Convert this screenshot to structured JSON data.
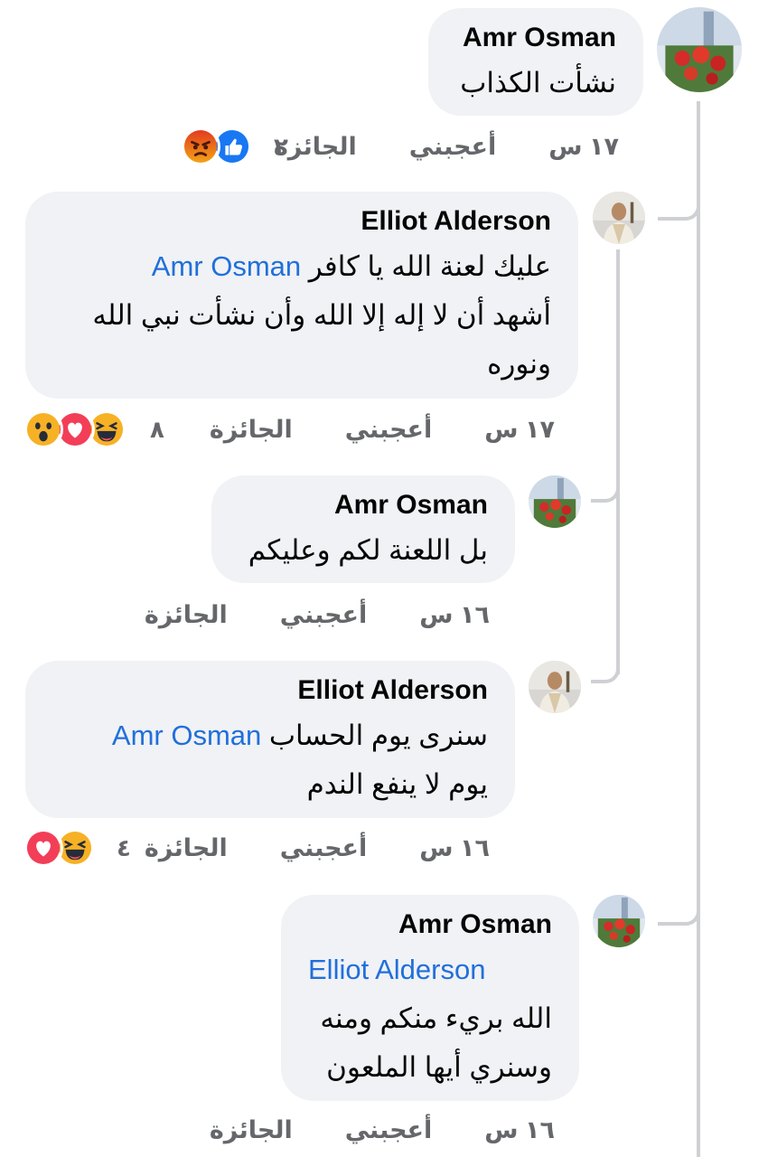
{
  "comments": [
    {
      "name": "Amr Osman",
      "lines": [
        "نشأت الكذاب"
      ],
      "time": "١٧ س",
      "like_label": "أعجبني",
      "award_label": "الجائزة",
      "reaction_count": "٢",
      "reactions": [
        "like-reaction-icon",
        "angry-reaction-icon"
      ]
    },
    {
      "name": "Elliot Alderson",
      "mention": "Amr Osman",
      "mention_tail": "عليك لعنة الله يا كافر",
      "lines": [
        "أشهد أن لا إله إلا الله وأن نشأت نبي الله",
        "ونوره"
      ],
      "time": "١٧ س",
      "like_label": "أعجبني",
      "award_label": "الجائزة",
      "reaction_count": "٨",
      "reactions": [
        "haha-reaction-icon",
        "love-reaction-icon",
        "wow-reaction-icon"
      ]
    },
    {
      "name": "Amr Osman",
      "lines": [
        "بل اللعنة لكم وعليكم"
      ],
      "time": "١٦ س",
      "like_label": "أعجبني",
      "award_label": "الجائزة"
    },
    {
      "name": "Elliot Alderson",
      "mention": "Amr Osman",
      "mention_tail": "سنرى يوم الحساب",
      "lines": [
        "يوم لا ينفع الندم"
      ],
      "time": "١٦ س",
      "like_label": "أعجبني",
      "award_label": "الجائزة",
      "reaction_count": "٤",
      "reactions": [
        "haha-reaction-icon",
        "love-reaction-icon"
      ]
    },
    {
      "name": "Amr Osman",
      "mention": "Elliot Alderson",
      "lines": [
        "الله بريء منكم ومنه",
        "وسنري أيها الملعون"
      ],
      "time": "١٦ س",
      "like_label": "أعجبني",
      "award_label": "الجائزة"
    }
  ],
  "colors": {
    "bubble": "#f0f2f5",
    "mention": "#216fdb",
    "meta": "#65676b",
    "like": "#1877f2",
    "love": "#f33e58",
    "angry": "#e9710f",
    "haha": "#f7b125"
  }
}
